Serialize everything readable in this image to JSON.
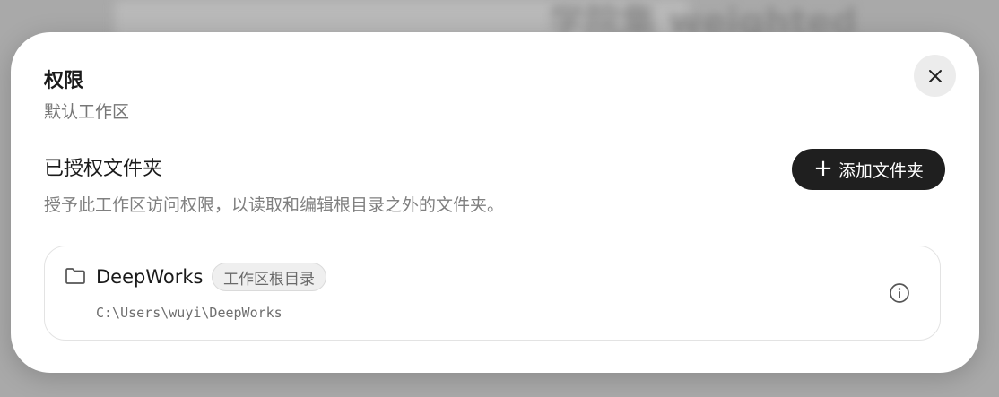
{
  "backdrop": {
    "text": "学院集 weighted"
  },
  "dialog": {
    "title": "权限",
    "subtitle": "默认工作区",
    "close_icon": "close-icon"
  },
  "authorized_folders": {
    "title": "已授权文件夹",
    "description": "授予此工作区访问权限，以读取和编辑根目录之外的文件夹。",
    "add_button": {
      "icon": "+",
      "label": "添加文件夹"
    },
    "items": [
      {
        "name": "DeepWorks",
        "badge": "工作区根目录",
        "path": "C:\\Users\\wuyi\\DeepWorks",
        "icon": "folder-icon",
        "action_icon": "info-icon"
      }
    ]
  }
}
